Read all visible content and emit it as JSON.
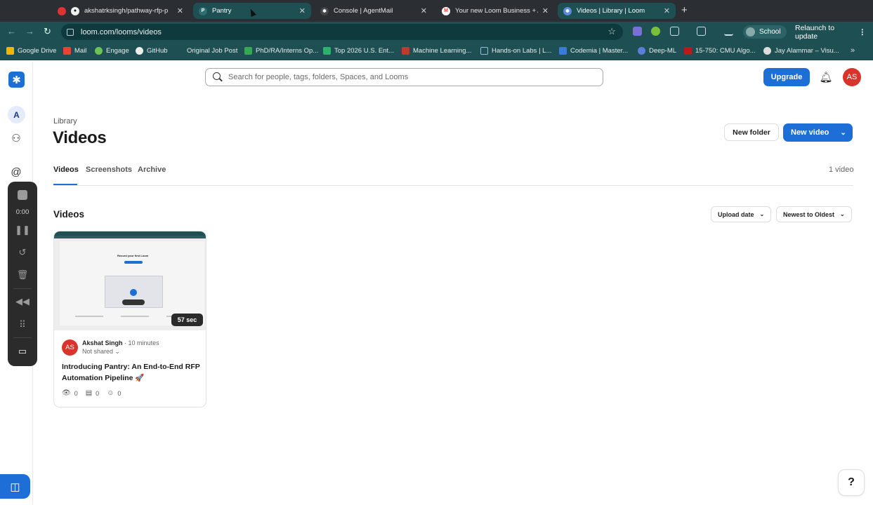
{
  "browser": {
    "tabs": [
      {
        "title": "akshatrksingh/pathway-rfp-p",
        "icon": "github-icon"
      },
      {
        "title": "Pantry",
        "icon": "pantry-icon"
      },
      {
        "title": "Console | AgentMail",
        "icon": "agentmail-icon"
      },
      {
        "title": "Your new Loom Business + A",
        "icon": "gmail-icon"
      },
      {
        "title": "Videos | Library | Loom",
        "icon": "loom-icon"
      }
    ],
    "new_tab": "+",
    "url": "loom.com/looms/videos",
    "profile_label": "School",
    "relaunch_label": "Relaunch to update",
    "bookmarks": [
      "Google Drive",
      "Mail",
      "Engage",
      "GitHub",
      "Original Job Post",
      "PhD/RA/Interns Op...",
      "Top 2026 U.S. Ent...",
      "Machine Learning...",
      "Hands-on Labs | L...",
      "Codemia | Master...",
      "Deep-ML",
      "15-750: CMU Algo...",
      "Jay Alammar – Visu..."
    ]
  },
  "rail": {
    "workspace_initial": "A",
    "timer": "0:00"
  },
  "header": {
    "search_placeholder": "Search for people, tags, folders, Spaces, and Looms",
    "upgrade_label": "Upgrade",
    "avatar_initials": "AS"
  },
  "library": {
    "breadcrumb": "Library",
    "title": "Videos",
    "new_folder_label": "New folder",
    "new_video_label": "New video",
    "tabs": [
      "Videos",
      "Screenshots",
      "Archive"
    ],
    "video_count": "1 video",
    "section_title": "Videos",
    "sort_field": "Upload date",
    "sort_order": "Newest to Oldest"
  },
  "video": {
    "thumb_heading": "Record your first Loom",
    "duration": "57 sec",
    "owner_initials": "AS",
    "owner": "Akshat Singh",
    "separator": "·",
    "time_ago": "10 minutes",
    "share_status": "Not shared",
    "title": "Introducing Pantry: An End-to-End RFP Automation Pipeline 🚀",
    "views": "0",
    "comments": "0",
    "reactions": "0"
  },
  "help_label": "?",
  "colors": {
    "accent": "#1d6fd7",
    "chrome": "#1e4f52",
    "avatar": "#d9342b"
  }
}
